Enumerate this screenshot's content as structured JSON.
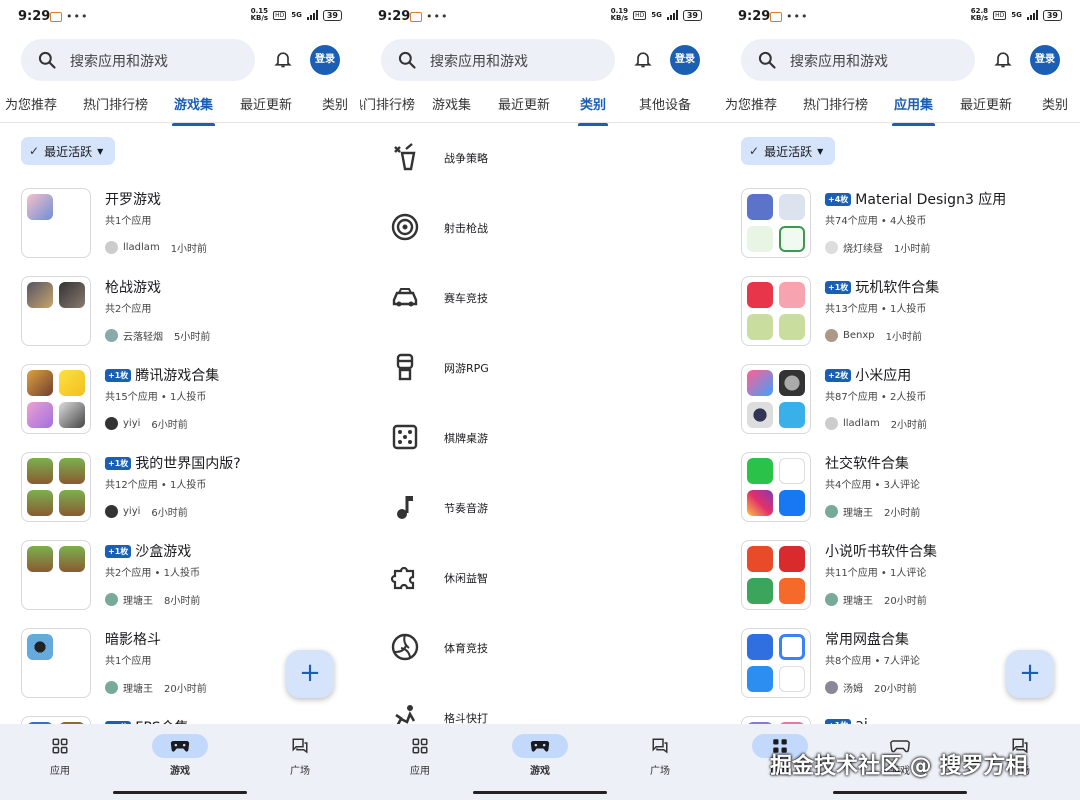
{
  "status": {
    "time": "9:29",
    "net1": "0.15",
    "net2": "0.19",
    "net3": "62.8",
    "netunit": "KB/s",
    "hd": "HD",
    "g": "5G",
    "battery": "39"
  },
  "search": {
    "placeholder": "搜索应用和游戏"
  },
  "login": "登录",
  "screen1": {
    "tabs": [
      "为您推荐",
      "热门排行榜",
      "游戏集",
      "最近更新",
      "类别"
    ],
    "chip": "最近活跃",
    "items": [
      {
        "title": "开罗游戏",
        "badge": "",
        "sub": "共1个应用",
        "user": "lladlam",
        "time": "1小时前"
      },
      {
        "title": "枪战游戏",
        "badge": "",
        "sub": "共2个应用",
        "user": "云落轻烟",
        "time": "5小时前"
      },
      {
        "title": "腾讯游戏合集",
        "badge": "+1枚",
        "sub": "共15个应用 • 1人投币",
        "user": "yiyi",
        "time": "6小时前"
      },
      {
        "title": "我的世界国内版?",
        "badge": "+1枚",
        "sub": "共12个应用 • 1人投币",
        "user": "yiyi",
        "time": "6小时前"
      },
      {
        "title": "沙盒游戏",
        "badge": "+1枚",
        "sub": "共2个应用 • 1人投币",
        "user": "理塘王",
        "time": "8小时前"
      },
      {
        "title": "暗影格斗",
        "badge": "",
        "sub": "共1个应用",
        "user": "理塘王",
        "time": "20小时前"
      },
      {
        "title": "FPS合集",
        "badge": "+1枚",
        "sub": "",
        "user": "",
        "time": ""
      }
    ]
  },
  "screen2": {
    "tabs": [
      "热门排行榜",
      "游戏集",
      "最近更新",
      "类别",
      "其他设备"
    ],
    "categories": [
      {
        "label": "战争策略",
        "icon": "strategy-icon"
      },
      {
        "label": "射击枪战",
        "icon": "target-icon"
      },
      {
        "label": "赛车竞技",
        "icon": "car-icon"
      },
      {
        "label": "网游RPG",
        "icon": "rpg-icon"
      },
      {
        "label": "棋牌桌游",
        "icon": "dice-icon"
      },
      {
        "label": "节奏音游",
        "icon": "music-note-icon"
      },
      {
        "label": "休闲益智",
        "icon": "puzzle-icon"
      },
      {
        "label": "体育竞技",
        "icon": "volleyball-icon"
      },
      {
        "label": "格斗快打",
        "icon": "fighting-icon"
      }
    ]
  },
  "screen3": {
    "tabs": [
      "为您推荐",
      "热门排行榜",
      "应用集",
      "最近更新",
      "类别"
    ],
    "chip": "最近活跃",
    "items": [
      {
        "title": "Material Design3 应用",
        "badge": "+4枚",
        "sub": "共74个应用 • 4人投币",
        "user": "烧灯续昼",
        "time": "1小时前"
      },
      {
        "title": "玩机软件合集",
        "badge": "+1枚",
        "sub": "共13个应用 • 1人投币",
        "user": "Benxp",
        "time": "1小时前"
      },
      {
        "title": "小米应用",
        "badge": "+2枚",
        "sub": "共87个应用 • 2人投币",
        "user": "lladlam",
        "time": "2小时前"
      },
      {
        "title": "社交软件合集",
        "badge": "",
        "sub": "共4个应用 • 3人评论",
        "user": "理塘王",
        "time": "2小时前"
      },
      {
        "title": "小说听书软件合集",
        "badge": "",
        "sub": "共11个应用 • 1人评论",
        "user": "理塘王",
        "time": "20小时前"
      },
      {
        "title": "常用网盘合集",
        "badge": "",
        "sub": "共8个应用 • 7人评论",
        "user": "汤姆",
        "time": "20小时前"
      },
      {
        "title": "ai",
        "badge": "+1枚",
        "sub": "",
        "user": "",
        "time": ""
      }
    ]
  },
  "nav": [
    "应用",
    "游戏",
    "广场"
  ],
  "watermark": "掘金技术社区 @ 搜罗方相",
  "colors": {
    "accent": "#1a5fb4",
    "chip": "#d5e3fb",
    "navbg": "#eef0f8"
  }
}
